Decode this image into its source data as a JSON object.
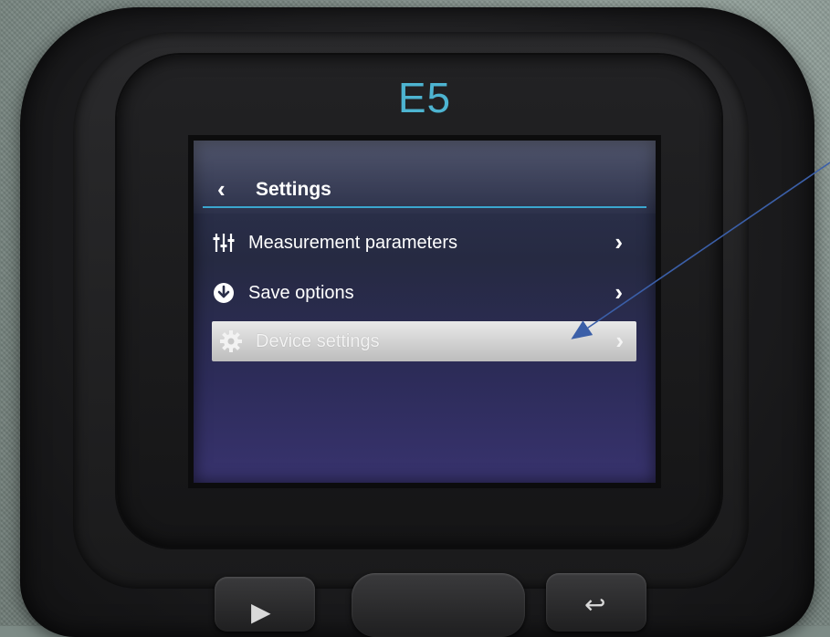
{
  "device": {
    "model": "E5"
  },
  "screen": {
    "header": {
      "back_icon": "‹",
      "title": "Settings"
    },
    "menu": [
      {
        "label": "Measurement parameters",
        "icon": "sliders-icon",
        "chevron": "›"
      },
      {
        "label": "Save options",
        "icon": "download-circle-icon",
        "chevron": "›"
      },
      {
        "label": "Device settings",
        "icon": "gear-icon",
        "chevron": "›",
        "selected": true
      }
    ]
  },
  "hardware_buttons": {
    "left_glyph": "▶",
    "right_glyph": "↩"
  },
  "colors": {
    "accent": "#3ba6cf",
    "model_label": "#4db4d1",
    "annotation_arrow": "#3b5fa8"
  }
}
